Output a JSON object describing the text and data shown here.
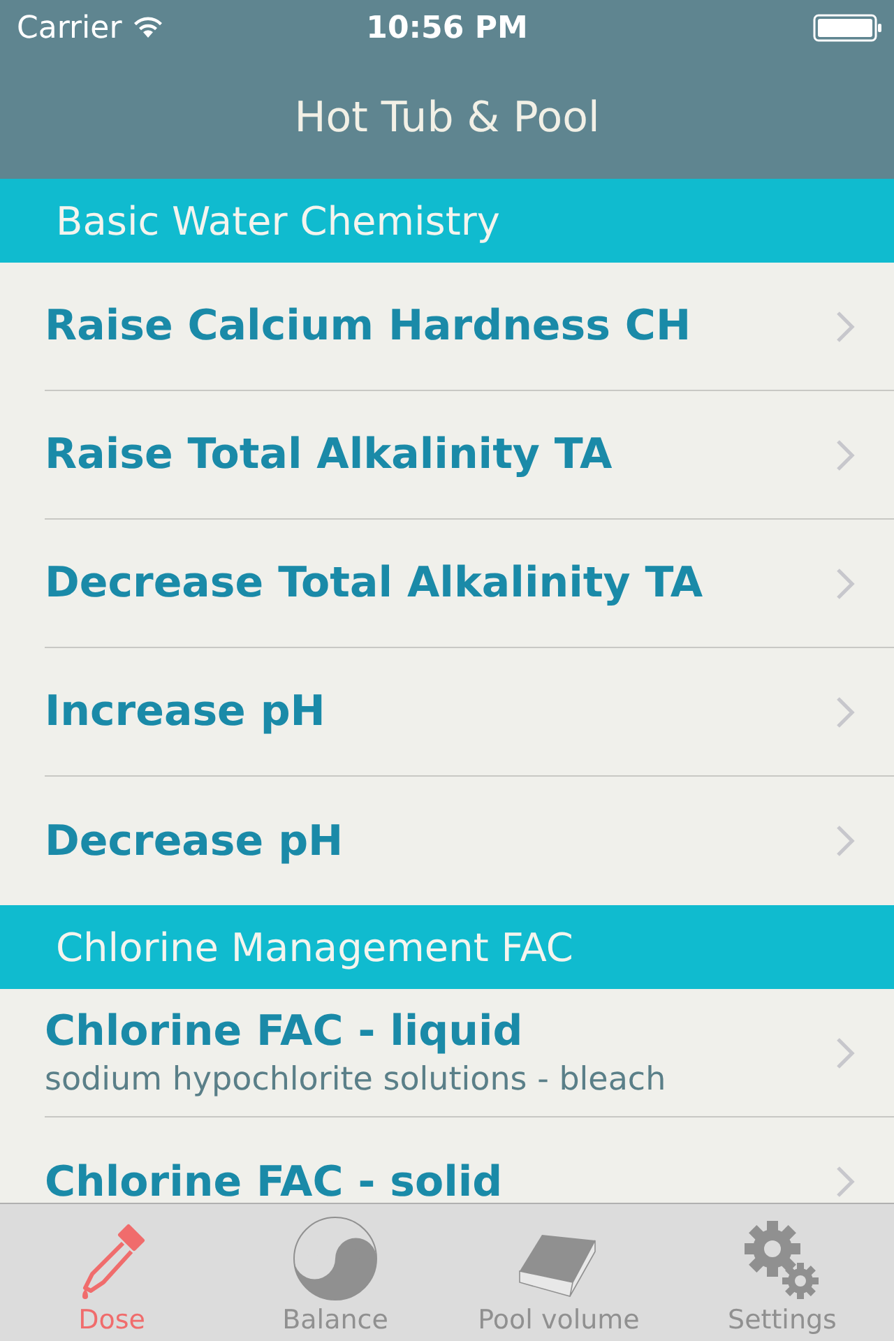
{
  "status_bar": {
    "carrier": "Carrier",
    "time": "10:56 PM"
  },
  "nav": {
    "title": "Hot Tub & Pool"
  },
  "sections": [
    {
      "header": "Basic Water Chemistry",
      "rows": [
        {
          "title": "Raise Calcium Hardness CH"
        },
        {
          "title": "Raise Total Alkalinity TA"
        },
        {
          "title": "Decrease Total Alkalinity TA"
        },
        {
          "title": "Increase pH"
        },
        {
          "title": "Decrease pH"
        }
      ]
    },
    {
      "header": "Chlorine Management FAC",
      "rows": [
        {
          "title": "Chlorine FAC - liquid",
          "subtitle": "sodium hypochlorite solutions - bleach"
        },
        {
          "title": "Chlorine FAC - solid"
        }
      ]
    }
  ],
  "tabs": [
    {
      "kind": "dropper",
      "label": "Dose",
      "selected": true
    },
    {
      "kind": "yinyang",
      "label": "Balance",
      "selected": false
    },
    {
      "kind": "slab",
      "label": "Pool volume",
      "selected": false
    },
    {
      "kind": "gears",
      "label": "Settings",
      "selected": false
    }
  ]
}
